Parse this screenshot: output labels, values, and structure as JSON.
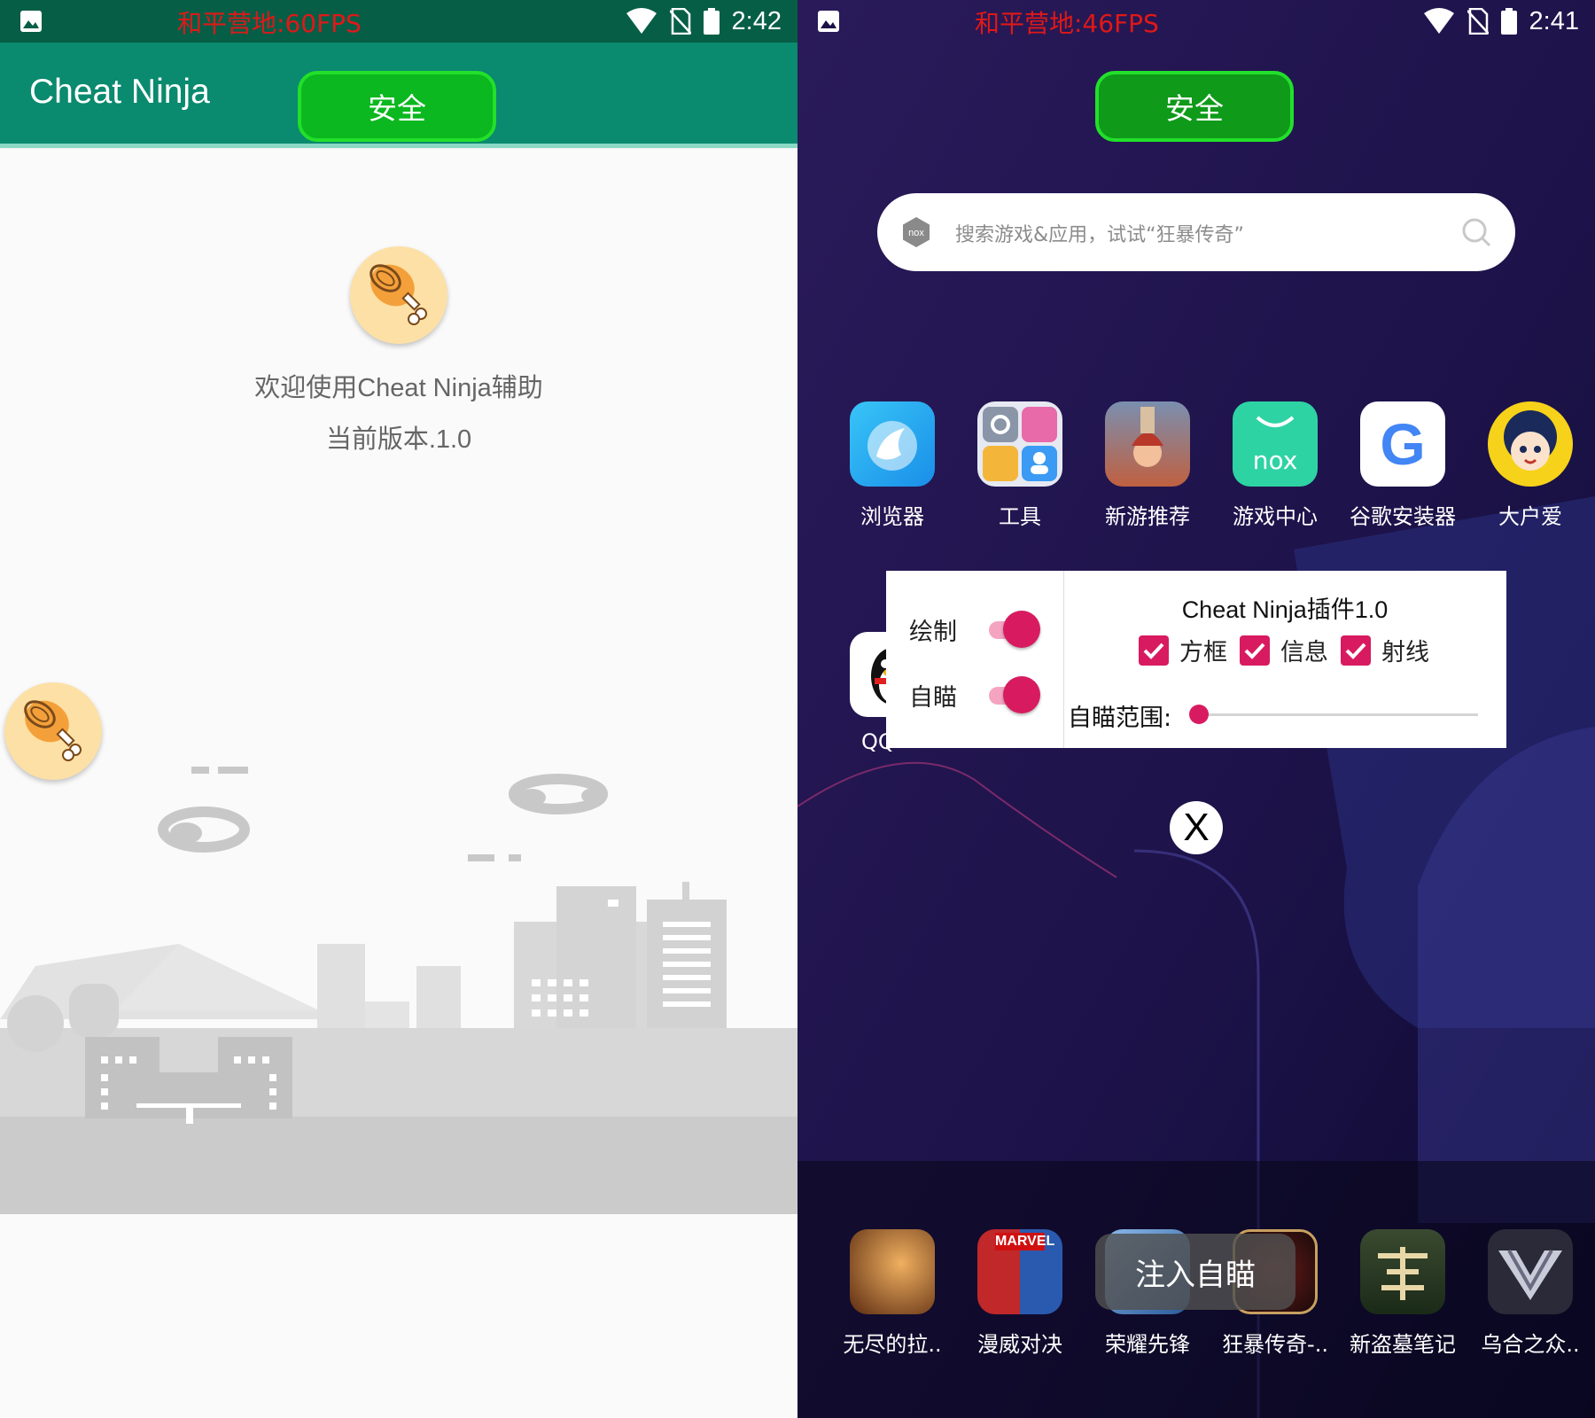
{
  "left_screen": {
    "status_bar": {
      "fps_label": "和平营地:60FPS",
      "time": "2:42"
    },
    "app_bar": {
      "title": "Cheat Ninja"
    },
    "safe_button": {
      "label": "安全"
    },
    "welcome_text": "欢迎使用Cheat Ninja辅助",
    "version_text": "当前版本.1.0"
  },
  "right_screen": {
    "status_bar": {
      "fps_label": "和平营地:46FPS",
      "time": "2:41"
    },
    "safe_button": {
      "label": "安全"
    },
    "search": {
      "logo_text": "nox",
      "placeholder": "搜索游戏&应用，试试“狂暴传奇”"
    },
    "apps_row1": [
      {
        "label": "浏览器",
        "icon": "browser-icon"
      },
      {
        "label": "工具",
        "icon": "tools-icon"
      },
      {
        "label": "新游推荐",
        "icon": "new-games-icon"
      },
      {
        "label": "游戏中心",
        "icon": "nox-game-center-icon",
        "icon_text": "nox"
      },
      {
        "label": "谷歌安装器",
        "icon": "google-installer-icon",
        "icon_text": "G"
      },
      {
        "label": "大户爱",
        "icon": "anime-girl-icon"
      }
    ],
    "partial_app": {
      "label": "QQ",
      "icon": "qq-penguin-icon"
    },
    "cheat_panel": {
      "title": "Cheat Ninja插件1.0",
      "toggles": [
        {
          "label": "绘制",
          "on": true
        },
        {
          "label": "自瞄",
          "on": true
        }
      ],
      "checkboxes": [
        {
          "label": "方框",
          "checked": true
        },
        {
          "label": "信息",
          "checked": true
        },
        {
          "label": "射线",
          "checked": true
        }
      ],
      "range_label": "自瞄范围:",
      "range_value": 0
    },
    "close_button": {
      "label": "X"
    },
    "toast": {
      "label": "注入自瞄"
    },
    "dock_apps": [
      {
        "label": "无尽的拉..",
        "icon": "endless-game-icon"
      },
      {
        "label": "漫威对决",
        "icon": "marvel-icon",
        "icon_text": "MARVEL"
      },
      {
        "label": "荣耀先锋",
        "icon": "honor-vanguard-icon"
      },
      {
        "label": "狂暴传奇-..",
        "icon": "rage-legend-icon"
      },
      {
        "label": "新盗墓笔记",
        "icon": "tomb-notes-icon"
      },
      {
        "label": "乌合之众..",
        "icon": "mob-game-icon"
      }
    ]
  },
  "colors": {
    "status_bar_green": "#075e46",
    "app_bar_teal": "#0a8a6e",
    "safe_button_green": "#0bb81f",
    "fps_red": "#e01818",
    "accent_pink": "#d81b60"
  }
}
